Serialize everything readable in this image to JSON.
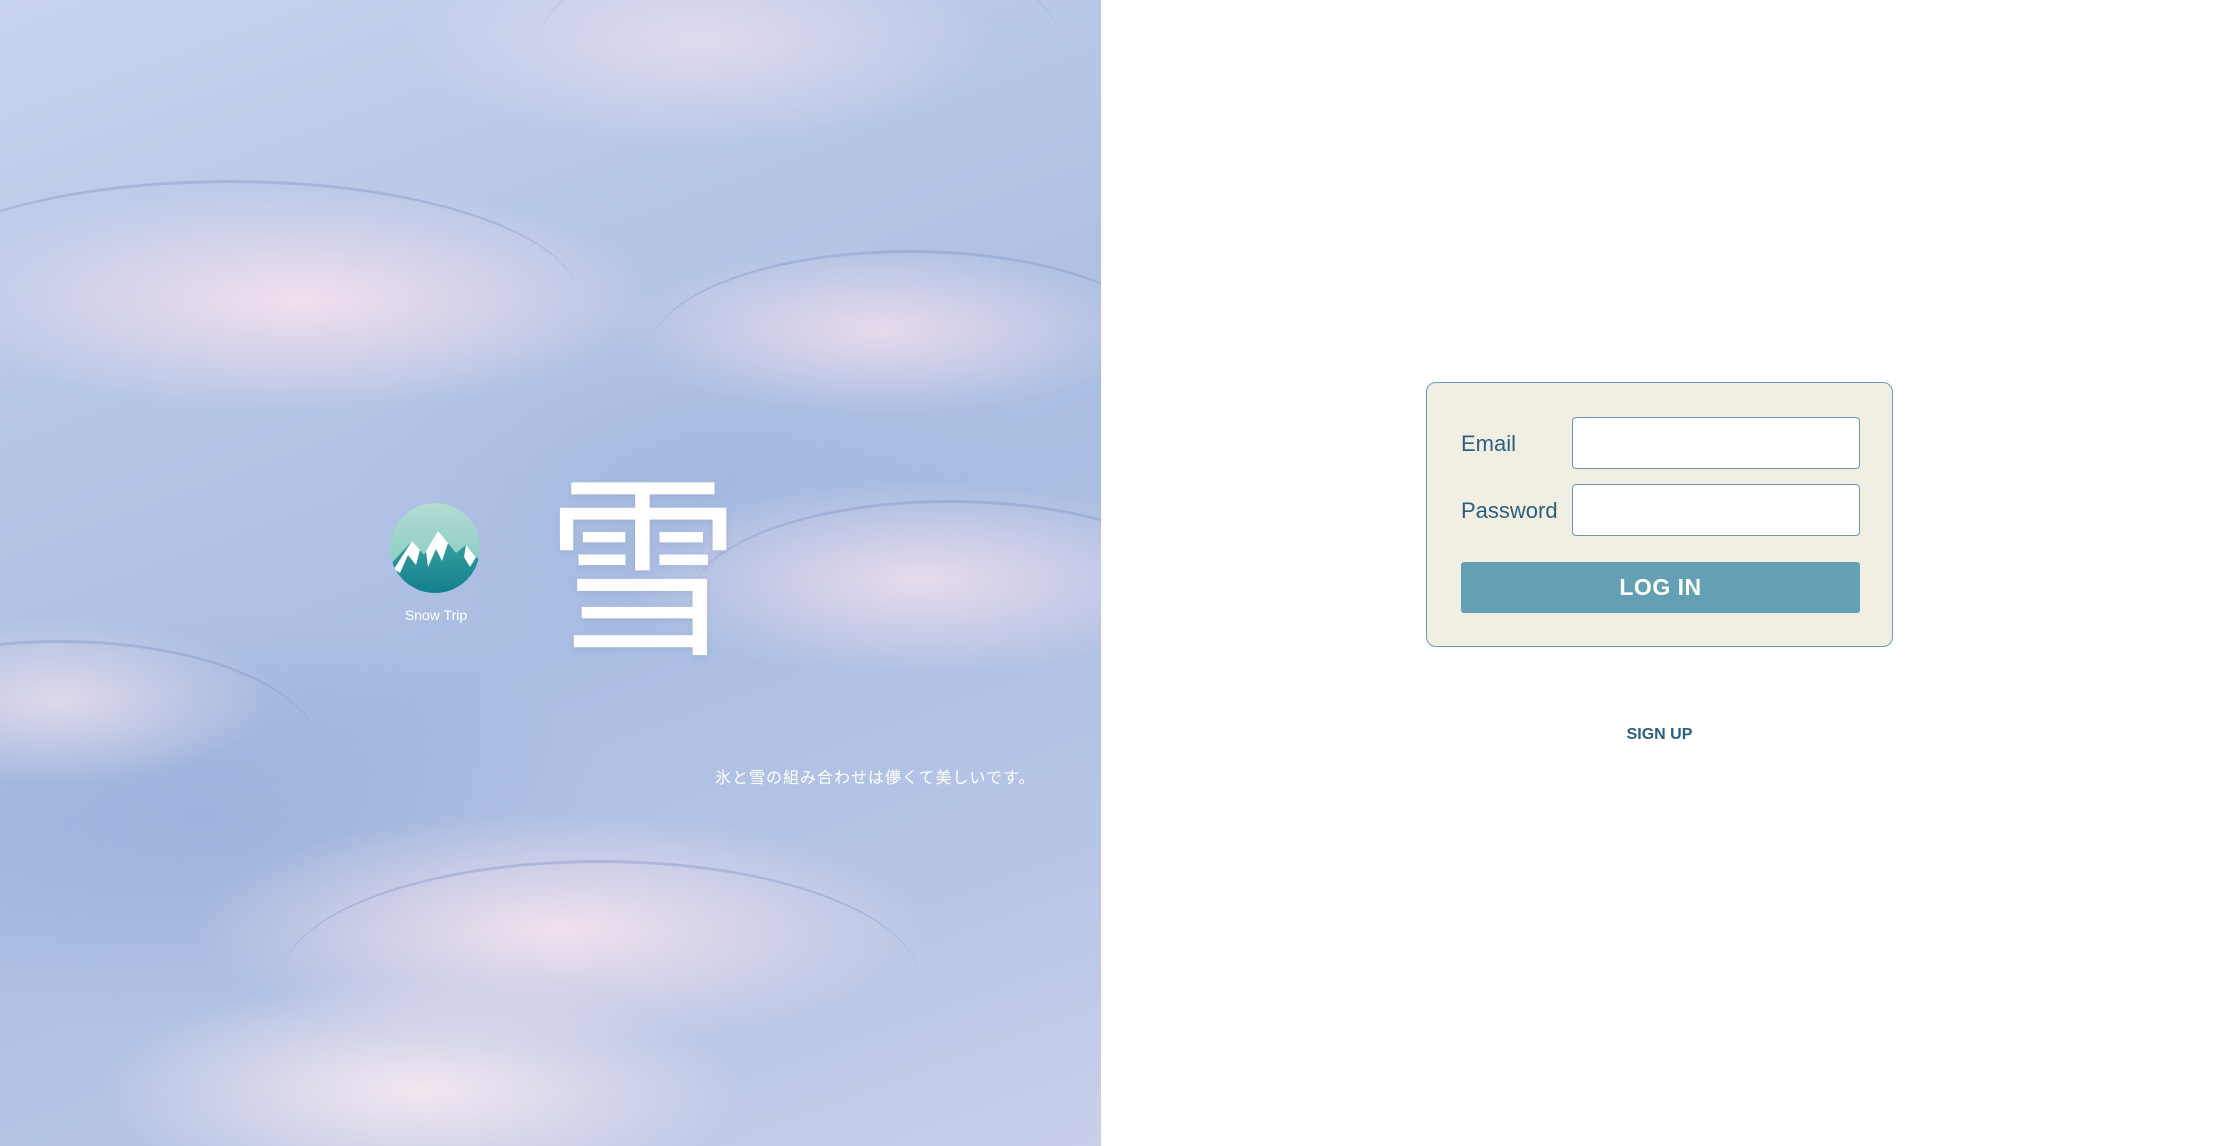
{
  "hero": {
    "brand_name": "Snow Trip",
    "kanji": "雪",
    "tagline": "氷と雪の組み合わせは儚くて美しいです。"
  },
  "logo": {
    "icon": "snow-mountain-icon",
    "colors": [
      "#a9d8cf",
      "#1e8f98",
      "#ffffff"
    ]
  },
  "login": {
    "email_label": "Email",
    "email_value": "",
    "password_label": "Password",
    "password_value": "",
    "submit_label": "LOG IN"
  },
  "signup": {
    "label": "SIGN UP"
  },
  "colors": {
    "card_background": "#f1efe4",
    "card_border": "#6b9db2",
    "button": "#64a0b3",
    "text": "#2c5f7e"
  }
}
